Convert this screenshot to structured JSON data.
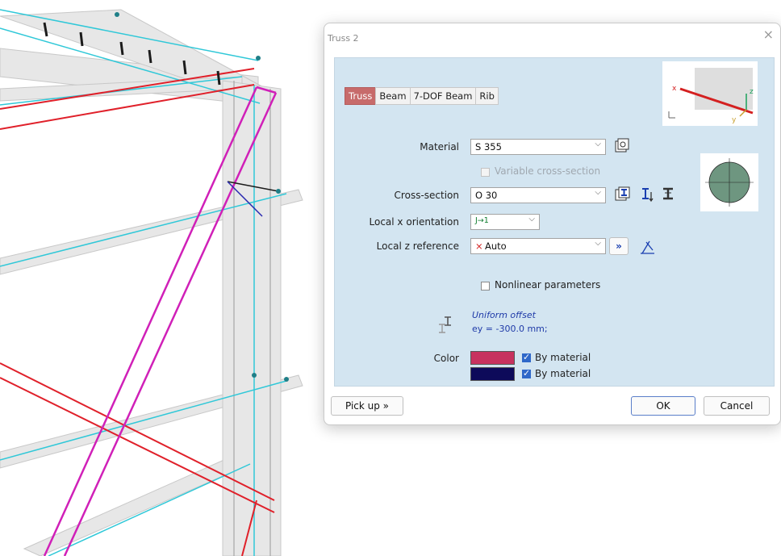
{
  "dialog": {
    "title": "Truss 2",
    "close_glyph": "×",
    "tabs": [
      {
        "label": "Truss",
        "active": true
      },
      {
        "label": "Beam",
        "active": false
      },
      {
        "label": "7-DOF Beam",
        "active": false
      },
      {
        "label": "Rib",
        "active": false
      }
    ],
    "orientation_preview": {
      "x_label": "x",
      "y_label": "y",
      "z_label": "z"
    },
    "fields": {
      "material": {
        "label": "Material",
        "value": "S 355"
      },
      "variable_cross_section": {
        "label": "Variable cross-section",
        "checked": false,
        "enabled": false
      },
      "cross_section": {
        "label": "Cross-section",
        "value": "O 30"
      },
      "local_x_orientation": {
        "label": "Local x orientation",
        "value": "J→1"
      },
      "local_z_reference": {
        "label": "Local z reference",
        "value": "Auto",
        "mark": "×",
        "expand": "»"
      },
      "nonlinear_parameters": {
        "label": "Nonlinear parameters",
        "checked": false
      }
    },
    "offset": {
      "title": "Uniform offset",
      "value": "ey = -300.0 mm;"
    },
    "color": {
      "label": "Color",
      "rows": [
        {
          "swatch": "#c7325f",
          "label": "By material",
          "checked": true
        },
        {
          "swatch": "#0d0a5a",
          "label": "By material",
          "checked": true
        }
      ]
    },
    "buttons": {
      "pickup": "Pick up »",
      "ok": "OK",
      "cancel": "Cancel"
    }
  },
  "colors": {
    "panel": "#d3e5f1",
    "active_tab": "#c76b6b",
    "accent": "#2f68c9"
  }
}
